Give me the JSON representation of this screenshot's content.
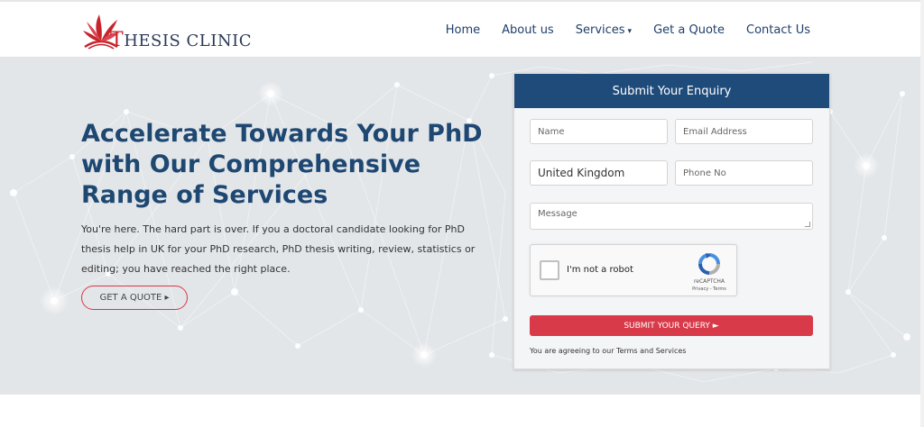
{
  "brand": {
    "logo_first_letter": "T",
    "logo_text": "HESIS CLINIC",
    "brand_red": "#c8232c",
    "brand_navy": "#2b3a55"
  },
  "nav": {
    "items": [
      {
        "label": "Home"
      },
      {
        "label": "About us"
      },
      {
        "label": "Services",
        "caret": "▾"
      },
      {
        "label": "Get a Quote"
      },
      {
        "label": "Contact Us"
      }
    ]
  },
  "hero": {
    "headline": "Accelerate Towards Your PhD with Our Comprehensive Range of Services",
    "subtext": "You're here. The hard part is over. If you a doctoral candidate looking for PhD thesis help in UK for your PhD research, PhD thesis writing, review, statistics or editing; you have reached the right place.",
    "cta_label": "GET A QUOTE ▸",
    "headline_color": "#1e4872"
  },
  "form": {
    "title": "Submit Your Enquiry",
    "header_color": "#1f4b7a",
    "name_placeholder": "Name",
    "email_placeholder": "Email Address",
    "country_value": "United Kingdom",
    "phone_placeholder": "Phone No",
    "message_placeholder": "Message",
    "captcha_label": "I'm not a robot",
    "captcha_brand": "reCAPTCHA",
    "captcha_terms": "Privacy - Terms",
    "submit_label": "SUBMIT YOUR QUERY ►",
    "submit_color": "#d93a49",
    "agree_text": "You are agreeing to our Terms and Services"
  }
}
